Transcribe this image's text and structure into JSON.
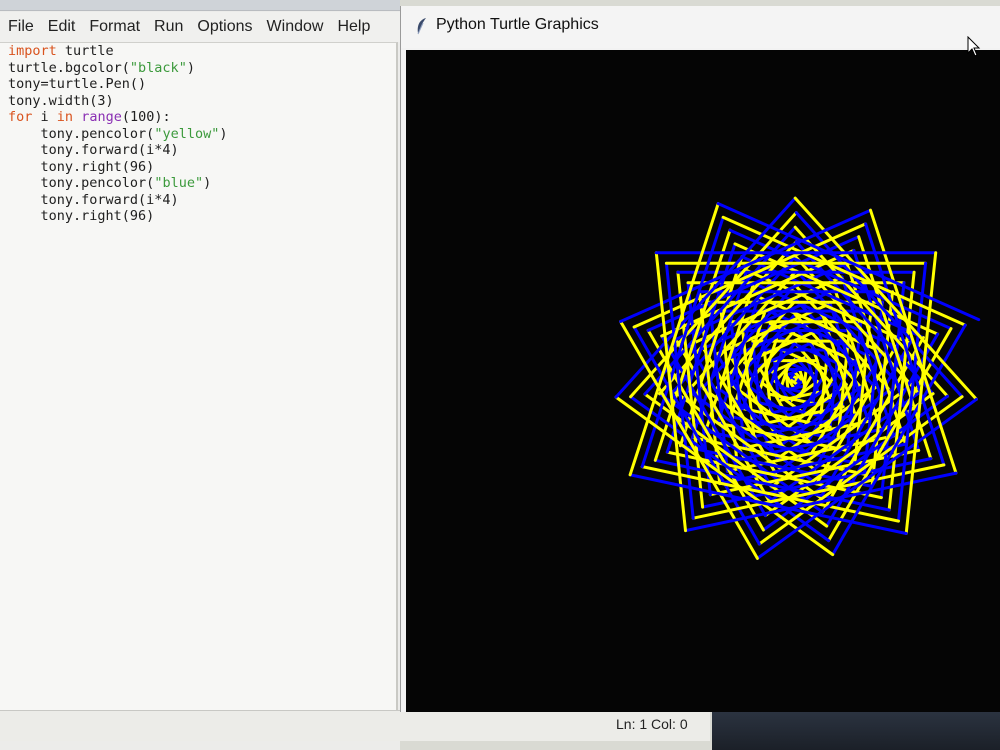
{
  "editor": {
    "menu": [
      "File",
      "Edit",
      "Format",
      "Run",
      "Options",
      "Window",
      "Help"
    ],
    "code": [
      [
        {
          "t": "import",
          "c": "kw"
        },
        {
          "t": " turtle",
          "c": ""
        }
      ],
      [
        {
          "t": "turtle.bgcolor(",
          "c": ""
        },
        {
          "t": "\"black\"",
          "c": "str"
        },
        {
          "t": ")",
          "c": ""
        }
      ],
      [
        {
          "t": "tony=turtle.Pen()",
          "c": ""
        }
      ],
      [
        {
          "t": "tony.width(3)",
          "c": ""
        }
      ],
      [
        {
          "t": "for",
          "c": "kw"
        },
        {
          "t": " i ",
          "c": ""
        },
        {
          "t": "in",
          "c": "kw"
        },
        {
          "t": " ",
          "c": ""
        },
        {
          "t": "range",
          "c": "bi"
        },
        {
          "t": "(100):",
          "c": ""
        }
      ],
      [
        {
          "t": "    tony.pencolor(",
          "c": ""
        },
        {
          "t": "\"yellow\"",
          "c": "str"
        },
        {
          "t": ")",
          "c": ""
        }
      ],
      [
        {
          "t": "    tony.forward(i*4)",
          "c": ""
        }
      ],
      [
        {
          "t": "    tony.right(96)",
          "c": ""
        }
      ],
      [
        {
          "t": "    tony.pencolor(",
          "c": ""
        },
        {
          "t": "\"blue\"",
          "c": "str"
        },
        {
          "t": ")",
          "c": ""
        }
      ],
      [
        {
          "t": "    tony.forward(i*4)",
          "c": ""
        }
      ],
      [
        {
          "t": "    tony.right(96)",
          "c": ""
        }
      ]
    ],
    "status": "Ln: 1  Col: 0"
  },
  "turtle_window": {
    "title": "Python Turtle Graphics",
    "icon": "feather-icon",
    "background": "#000000",
    "pen_colors": [
      "#ffff00",
      "#0000ff"
    ]
  }
}
